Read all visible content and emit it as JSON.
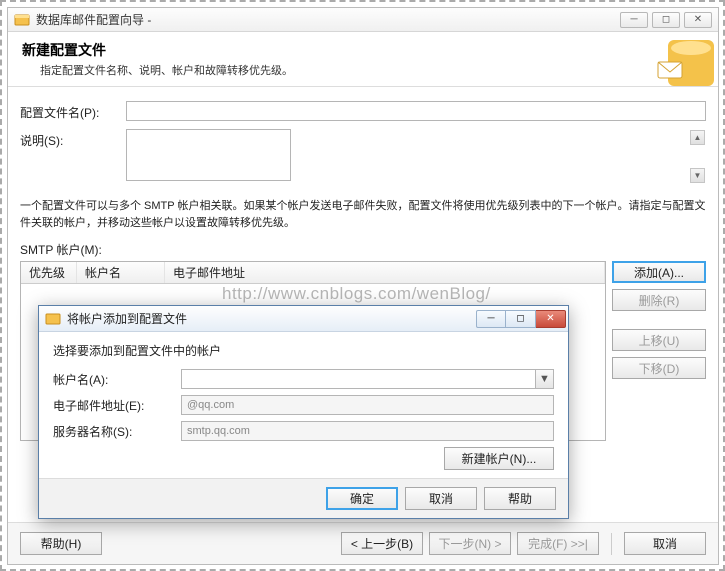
{
  "window": {
    "title": "数据库邮件配置向导 -",
    "header_title": "新建配置文件",
    "header_subtitle": "指定配置文件名称、说明、帐户和故障转移优先级。"
  },
  "form": {
    "profile_name_label": "配置文件名(P):",
    "description_label": "说明(S):",
    "profile_name_value": "",
    "description_value": ""
  },
  "info_text": "一个配置文件可以与多个 SMTP 帐户相关联。如果某个帐户发送电子邮件失败，配置文件将使用优先级列表中的下一个帐户。请指定与配置文件关联的帐户，并移动这些帐户以设置故障转移优先级。",
  "smtp": {
    "label": "SMTP 帐户(M):",
    "col_priority": "优先级",
    "col_name": "帐户名",
    "col_email": "电子邮件地址",
    "btn_add": "添加(A)...",
    "btn_remove": "删除(R)",
    "btn_up": "上移(U)",
    "btn_down": "下移(D)"
  },
  "footer": {
    "help": "帮助(H)",
    "back": "< 上一步(B)",
    "next": "下一步(N) >",
    "finish": "完成(F) >>|",
    "cancel": "取消"
  },
  "dialog": {
    "title": "将帐户添加到配置文件",
    "prompt": "选择要添加到配置文件中的帐户",
    "account_label": "帐户名(A):",
    "account_value": "",
    "email_label": "电子邮件地址(E):",
    "email_value": "@qq.com",
    "server_label": "服务器名称(S):",
    "server_value": "smtp.qq.com",
    "new_account": "新建帐户(N)...",
    "ok": "确定",
    "cancel": "取消",
    "help": "帮助"
  },
  "watermark": "http://www.cnblogs.com/wenBlog/"
}
